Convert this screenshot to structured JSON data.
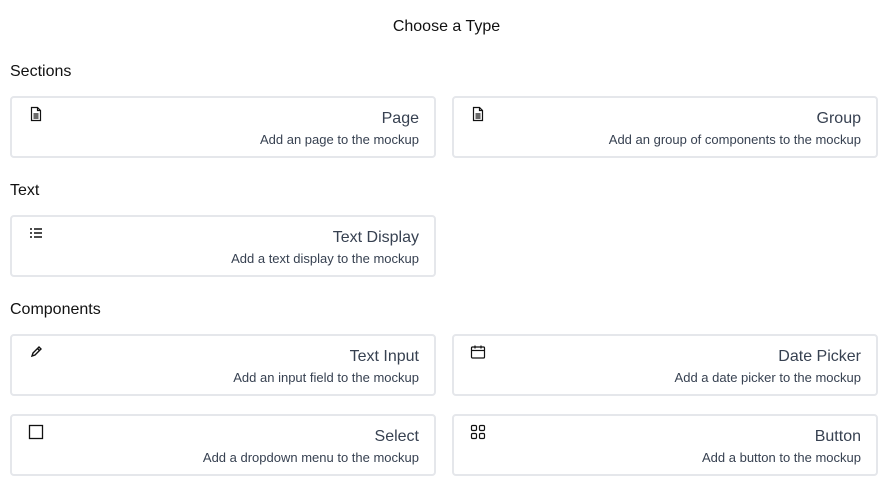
{
  "title": "Choose a Type",
  "sections": [
    {
      "label": "Sections",
      "items": [
        {
          "name": "Page",
          "description": "Add an page to the mockup",
          "icon": "document-icon"
        },
        {
          "name": "Group",
          "description": "Add an group of components to the mockup",
          "icon": "document-icon"
        }
      ]
    },
    {
      "label": "Text",
      "items": [
        {
          "name": "Text Display",
          "description": "Add a text display to the mockup",
          "icon": "list-icon"
        }
      ]
    },
    {
      "label": "Components",
      "items": [
        {
          "name": "Text Input",
          "description": "Add an input field to the mockup",
          "icon": "pencil-icon"
        },
        {
          "name": "Date Picker",
          "description": "Add a date picker to the mockup",
          "icon": "calendar-icon"
        },
        {
          "name": "Select",
          "description": "Add a dropdown menu to the mockup",
          "icon": "square-icon"
        },
        {
          "name": "Button",
          "description": "Add a button to the mockup",
          "icon": "grid-icon"
        }
      ]
    }
  ]
}
